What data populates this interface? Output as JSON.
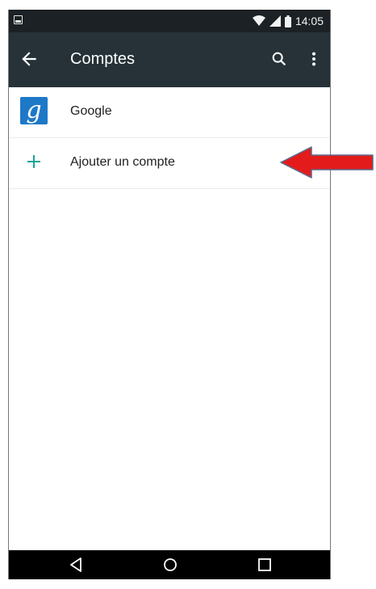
{
  "status_bar": {
    "time": "14:05",
    "icons": [
      "notification-image-icon",
      "wifi-icon",
      "signal-icon",
      "battery-icon"
    ]
  },
  "app_bar": {
    "title": "Comptes",
    "back_icon": "arrow-left-icon",
    "search_icon": "search-icon",
    "more_icon": "more-vert-icon",
    "background": "#263238"
  },
  "accounts": [
    {
      "label": "Google",
      "icon": "google-g-icon",
      "icon_color": "#1e78c8"
    }
  ],
  "add_account": {
    "label": "Ajouter un compte",
    "icon": "plus-icon",
    "icon_color": "#1aa39a"
  },
  "nav_bar": {
    "icons": [
      "back-triangle-icon",
      "home-circle-icon",
      "recents-square-icon"
    ]
  },
  "annotation": {
    "type": "arrow",
    "color": "#e31b1b",
    "points_to": "add-account-row"
  }
}
